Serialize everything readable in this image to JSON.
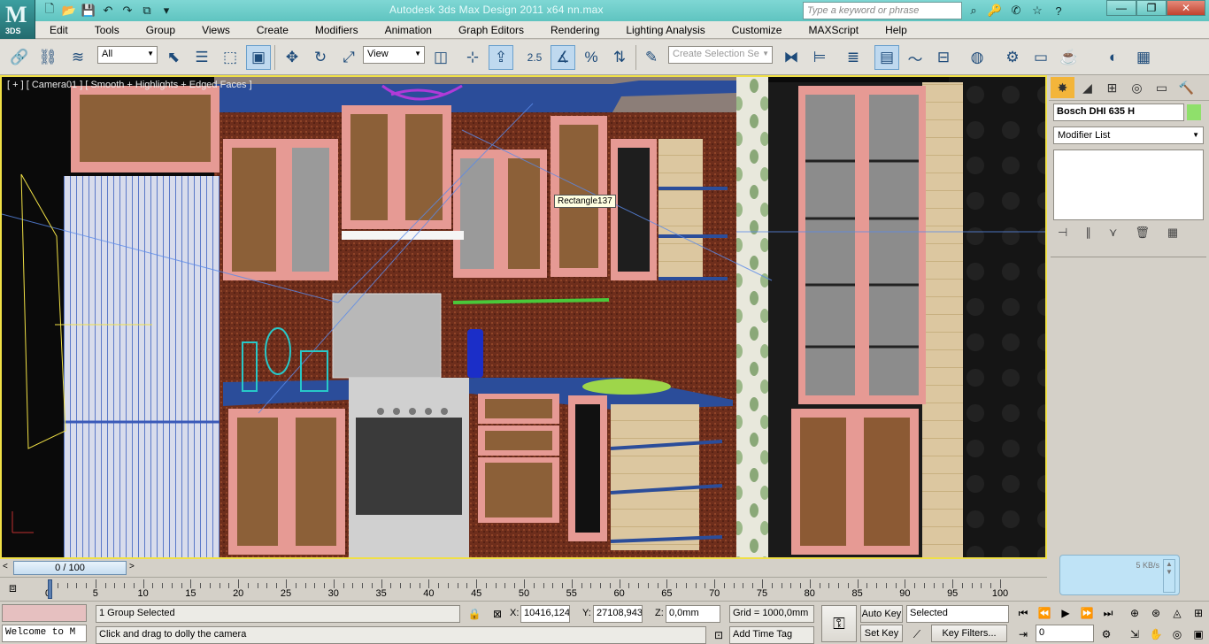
{
  "app": {
    "logo_text": "3DS",
    "logo_glyph": "M",
    "title": "Autodesk 3ds Max Design 2011 x64      nn.max"
  },
  "search": {
    "placeholder": "Type a keyword or phrase"
  },
  "menu": [
    "Edit",
    "Tools",
    "Group",
    "Views",
    "Create",
    "Modifiers",
    "Animation",
    "Graph Editors",
    "Rendering",
    "Lighting Analysis",
    "Customize",
    "MAXScript",
    "Help"
  ],
  "toolbar": {
    "selection_filter": "All",
    "reference_coord": "View",
    "snap_value": "2.5",
    "named_selection_placeholder": "Create Selection Se"
  },
  "viewport": {
    "label": "[ + ] [ Camera01 ] [ Smooth + Highlights + Edged Faces ]",
    "tooltip": "Rectangle137"
  },
  "command_panel": {
    "object_name": "Bosch DHI 635 H",
    "object_color": "#8fe06b",
    "modifier_list": "Modifier List"
  },
  "time_slider": {
    "position": "0 / 100",
    "left_arrow": "<",
    "right_arrow": ">"
  },
  "trackbar": {
    "ticks": [
      0,
      5,
      10,
      15,
      20,
      25,
      30,
      35,
      40,
      45,
      50,
      55,
      60,
      65,
      70,
      75,
      80,
      85,
      90,
      95,
      100
    ]
  },
  "net_monitor": {
    "rate": "5 KB/s"
  },
  "status": {
    "maxscript_listener": "Welcome to M",
    "selection": "1 Group Selected",
    "prompt": "Click and drag to dolly the camera",
    "x_label": "X:",
    "x_value": "10416,124",
    "y_label": "Y:",
    "y_value": "27108,943",
    "z_label": "Z:",
    "z_value": "0,0mm",
    "grid": "Grid = 1000,0mm",
    "add_time_tag": "Add Time Tag",
    "auto_key": "Auto Key",
    "set_key": "Set Key",
    "key_mode": "Selected",
    "key_filters": "Key Filters...",
    "current_frame": "0"
  }
}
